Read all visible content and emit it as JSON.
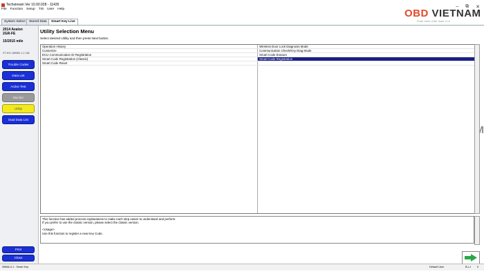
{
  "window": {
    "title": "Techstream Ver 10.00.028  -  11435",
    "controls": [
      "–",
      "⧉",
      "✕"
    ]
  },
  "menu": [
    "File",
    "Function",
    "Setup",
    "TIS",
    "User",
    "Help"
  ],
  "tabs": [
    {
      "label": "System Select",
      "active": false
    },
    {
      "label": "Stored Data",
      "active": false
    },
    {
      "label": "Smart Key Live",
      "active": true
    }
  ],
  "vehicle": {
    "model": "2014 Avalon",
    "engine": "2GR-FE",
    "mode": "15/2015 mile",
    "vin": "VT 4H1 1800BJ 1-1 136"
  },
  "left_buttons": [
    {
      "label": "Trouble Codes",
      "style": "blue"
    },
    {
      "label": "Data List",
      "style": "blue"
    },
    {
      "label": "Active Test",
      "style": "blue"
    },
    {
      "label": "Monitor",
      "style": "gray"
    },
    {
      "label": "Utility",
      "style": "yellow"
    },
    {
      "label": "Dual Data List",
      "style": "blue"
    }
  ],
  "bottom_buttons": {
    "print": "Print",
    "close": "Close"
  },
  "main": {
    "title": "Utility Selection Menu",
    "subtitle": "Select desired Utility and then press Next button.",
    "rows": [
      {
        "left": "Operation History",
        "right": "Wireless Door Lock Diagnosis Mode",
        "selected_right": false
      },
      {
        "left": "Customize",
        "right": "Communication Check/Key Diag Mode",
        "selected_right": false
      },
      {
        "left": "ECU Communication ID Registration",
        "right": "Smart Code Erasure",
        "selected_right": false
      },
      {
        "left": "Smart Code Registration (Classic)",
        "right": "Smart Code Registration",
        "selected_right": true
      },
      {
        "left": "Smart Code Reset",
        "right": "",
        "selected_right": false
      }
    ],
    "description": [
      "This function has added process explanations to make each step easier to understand and perform.",
      "If you prefer to use the classic version, please select the classic version.",
      "",
      "<Usage>",
      "Use this function to register a new Key Code."
    ]
  },
  "status": {
    "left": "39666-4-1 : Smart Key",
    "user": "Default User",
    "code": "B-LJ",
    "num": "0"
  },
  "watermark": {
    "obd": "OBD",
    "viet": "VIETNAM",
    "tagline": "Phần mềm chẩn đoán ô tô"
  },
  "colors": {
    "primary_button": "#1a2fd6",
    "selected_row": "#1a1f8a",
    "active_utility": "#f2ea1e",
    "logo_red": "#e24a2a"
  }
}
